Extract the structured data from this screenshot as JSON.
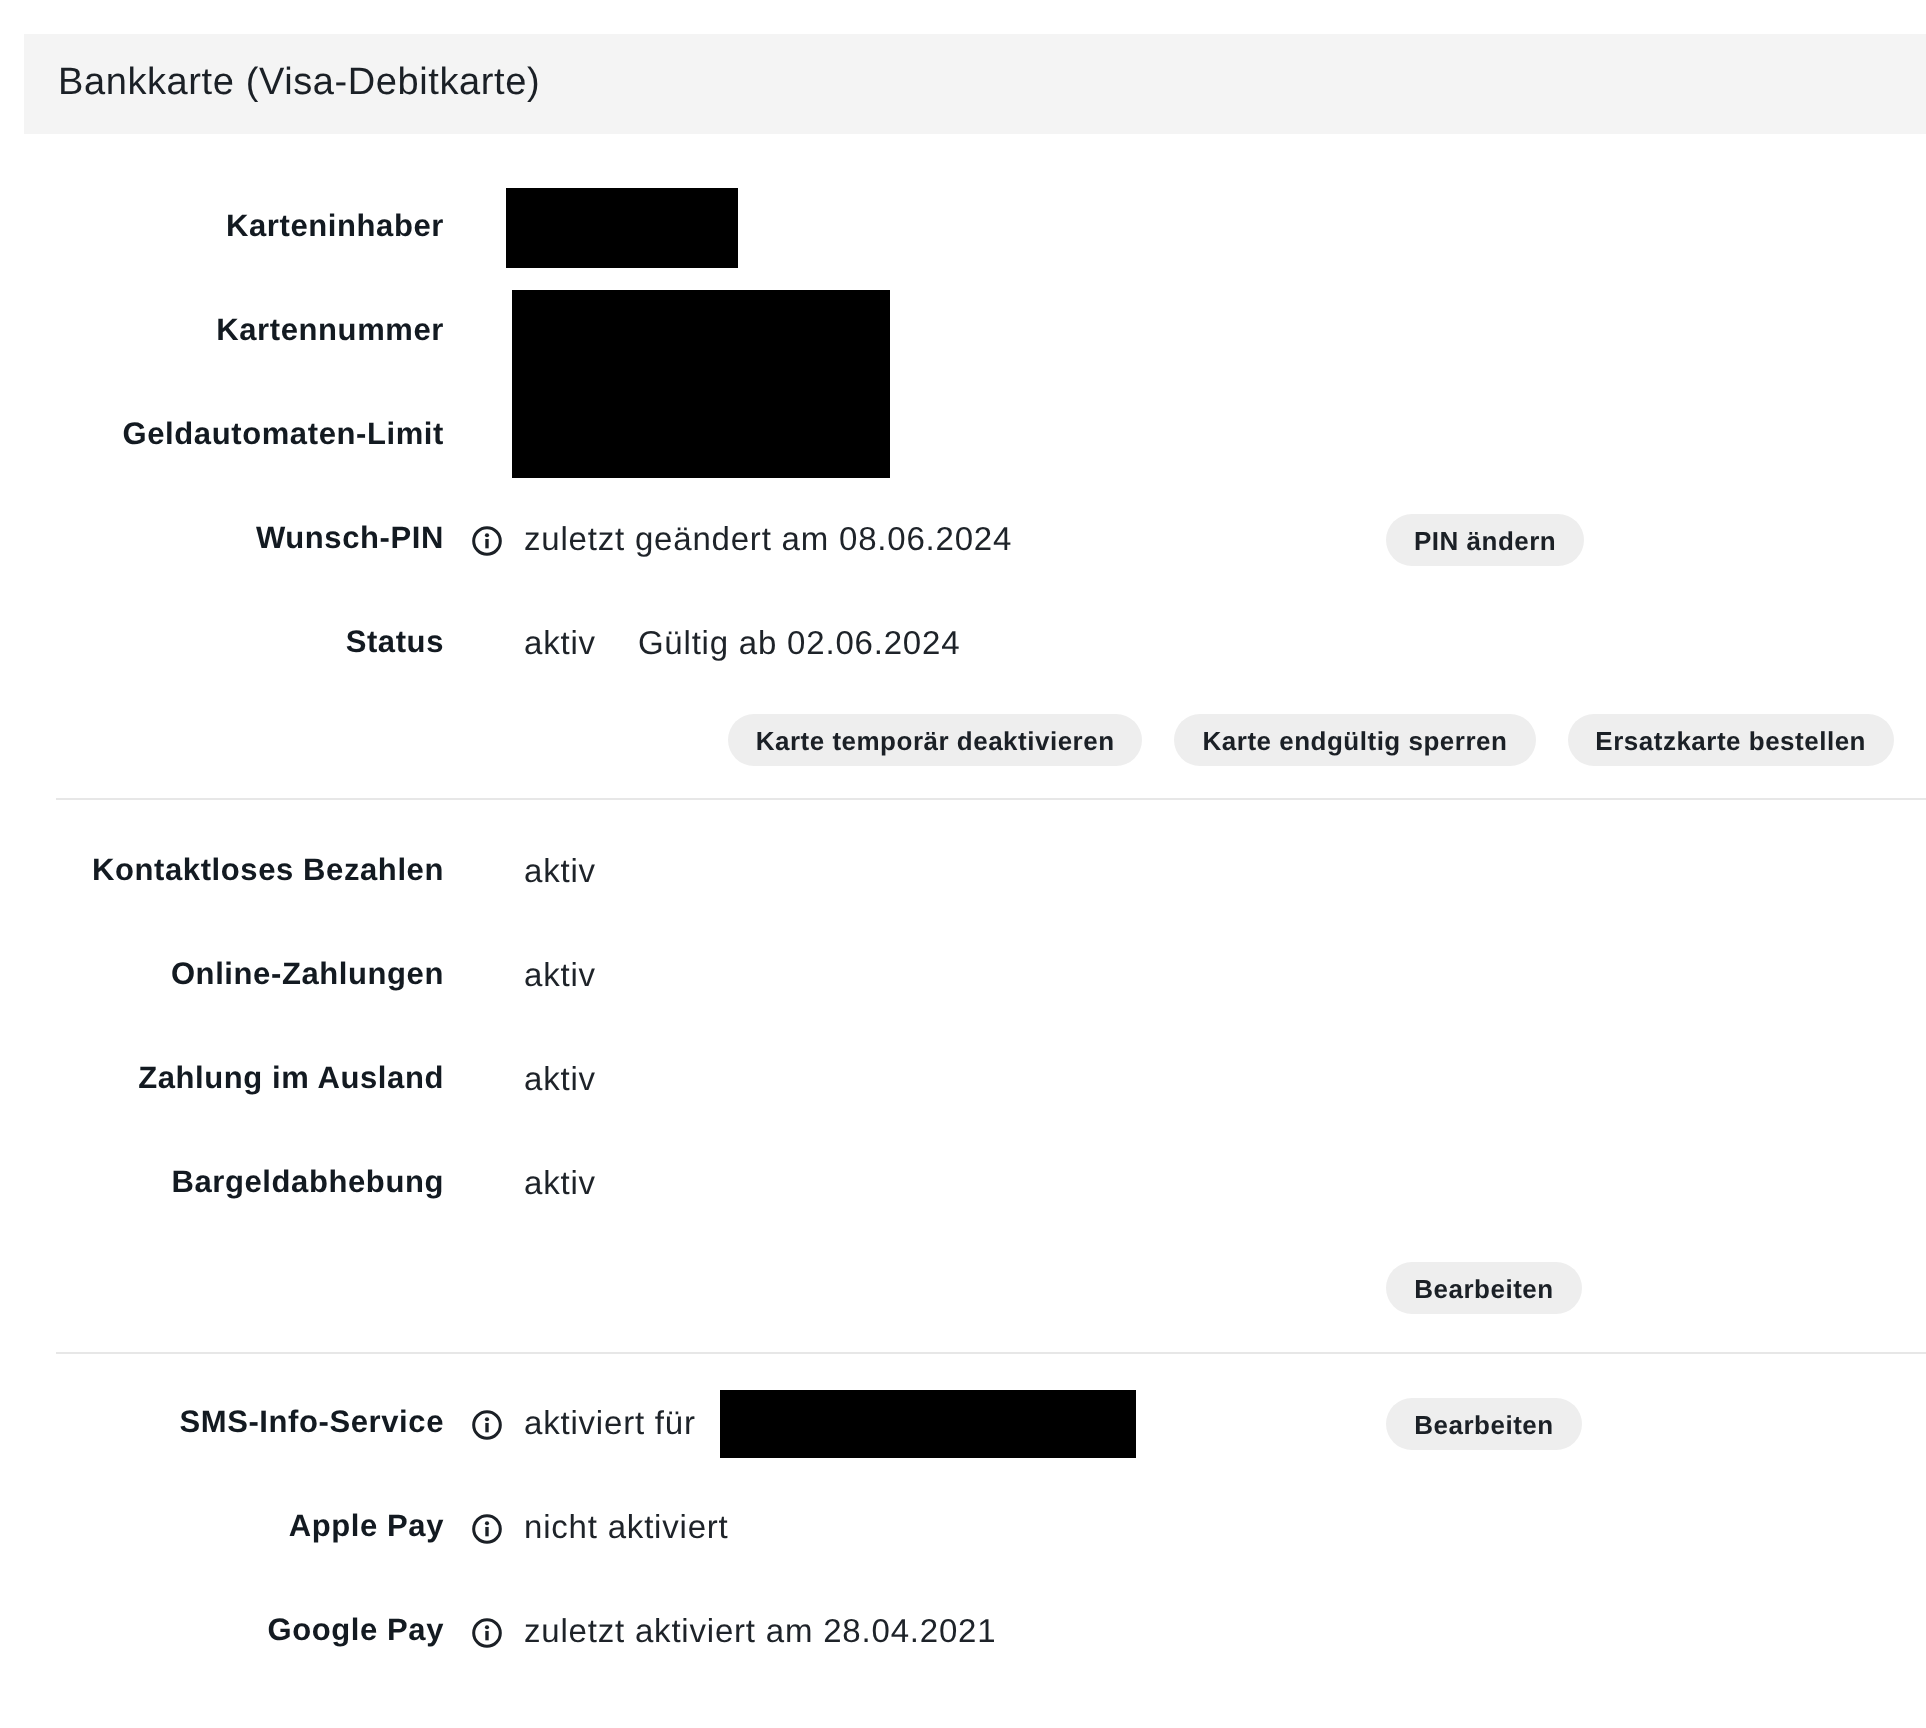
{
  "card": {
    "title": "Bankkarte (Visa-Debitkarte)"
  },
  "sections": [
    {
      "rows": [
        {
          "label": "Karteninhaber",
          "kind": "redacted"
        },
        {
          "label": "Kartennummer",
          "kind": "redacted-span"
        },
        {
          "label": "Geldautomaten-Limit",
          "kind": "redacted-span"
        },
        {
          "label": "Wunsch-PIN",
          "kind": "info",
          "value": "zuletzt geändert am 08.06.2024",
          "button": "PIN ändern"
        },
        {
          "label": "Status",
          "kind": "plain",
          "value": "aktiv",
          "note": "Gültig ab 02.06.2024"
        }
      ],
      "actions": [
        "Karte temporär deaktivieren",
        "Karte endgültig sperren",
        "Ersatzkarte bestellen"
      ]
    },
    {
      "rows": [
        {
          "label": "Kontaktloses Bezahlen",
          "kind": "plain",
          "value": "aktiv"
        },
        {
          "label": "Online-Zahlungen",
          "kind": "plain",
          "value": "aktiv"
        },
        {
          "label": "Zahlung im Ausland",
          "kind": "plain",
          "value": "aktiv"
        },
        {
          "label": "Bargeldabhebung",
          "kind": "plain",
          "value": "aktiv"
        }
      ],
      "edit_button": "Bearbeiten"
    },
    {
      "rows": [
        {
          "label": "SMS-Info-Service",
          "kind": "info-redacted",
          "value": "aktiviert für",
          "button": "Bearbeiten"
        },
        {
          "label": "Apple Pay",
          "kind": "info",
          "value": "nicht aktiviert"
        },
        {
          "label": "Google Pay",
          "kind": "info",
          "value": "zuletzt aktiviert am 28.04.2021"
        }
      ]
    }
  ]
}
